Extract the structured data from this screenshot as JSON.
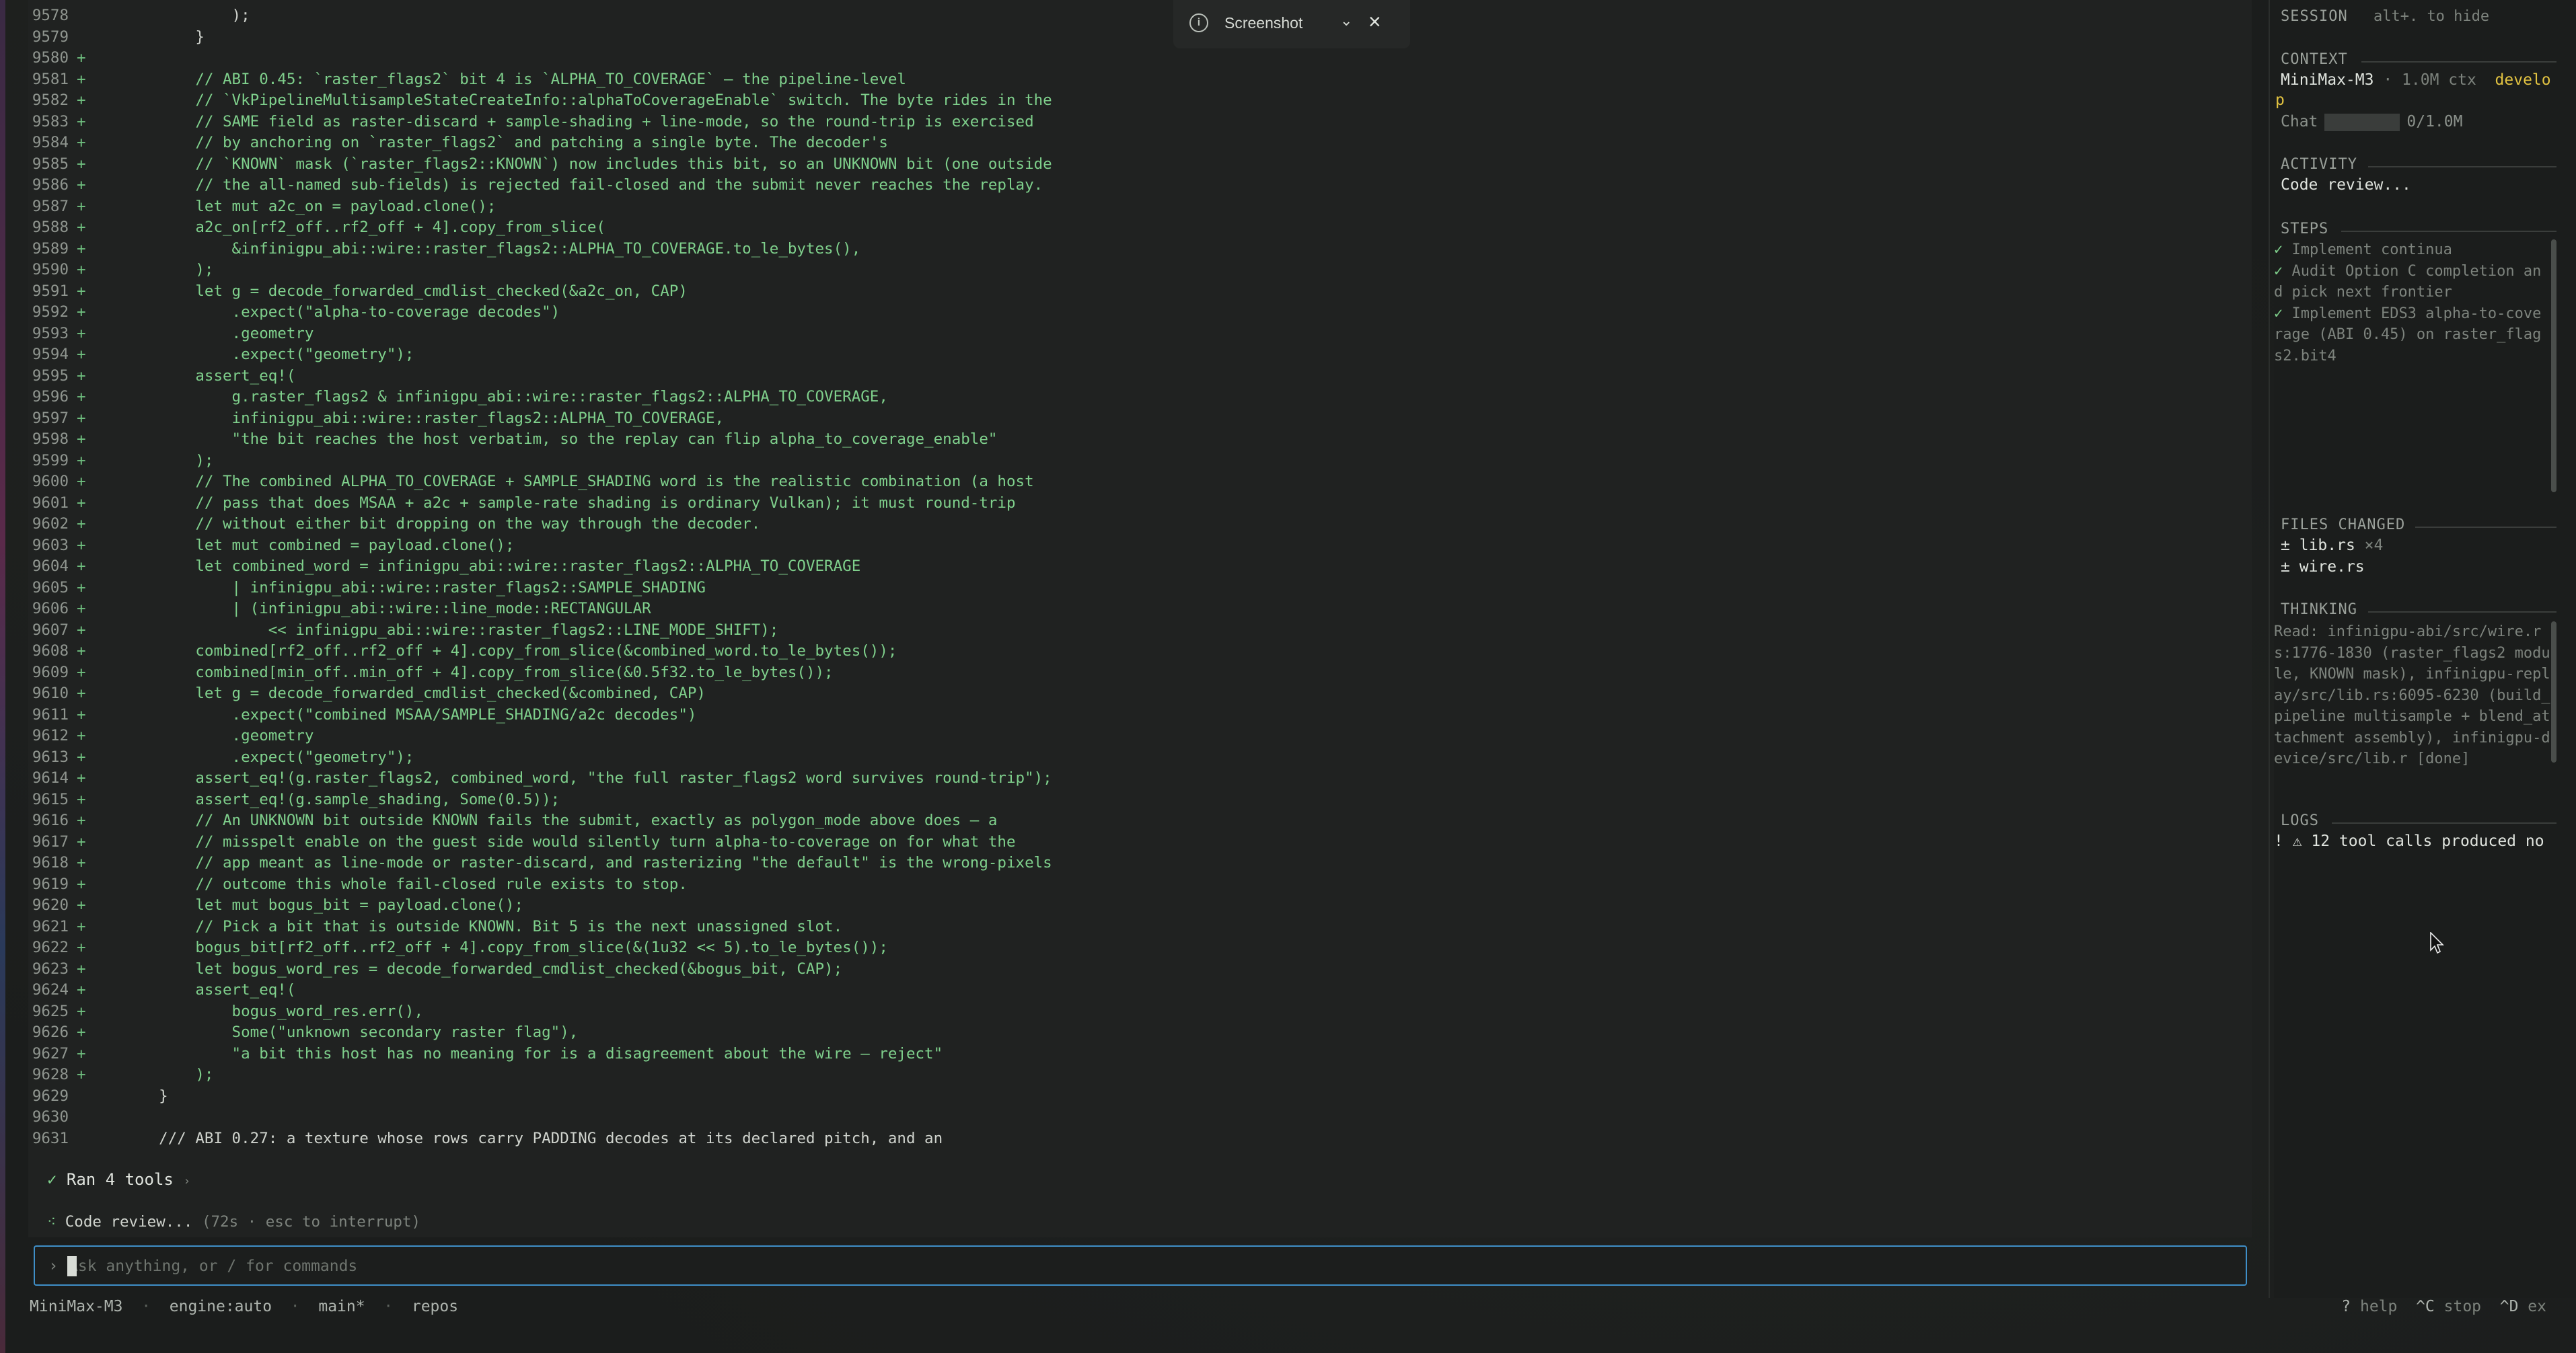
{
  "popup": {
    "title": "Screenshot",
    "info_icon": "info-icon",
    "chevron_icon": "chevron-down-icon",
    "close_icon": "close-icon"
  },
  "code_lines": [
    {
      "n": "9578",
      "m": "",
      "t": "            );",
      "k": "plain"
    },
    {
      "n": "9579",
      "m": "",
      "t": "        }",
      "k": "plain"
    },
    {
      "n": "9580",
      "m": "+",
      "t": "",
      "k": "add"
    },
    {
      "n": "9581",
      "m": "+",
      "t": "        // ABI 0.45: `raster_flags2` bit 4 is `ALPHA_TO_COVERAGE` — the pipeline-level",
      "k": "add"
    },
    {
      "n": "9582",
      "m": "+",
      "t": "        // `VkPipelineMultisampleStateCreateInfo::alphaToCoverageEnable` switch. The byte rides in the",
      "k": "add"
    },
    {
      "n": "9583",
      "m": "+",
      "t": "        // SAME field as raster-discard + sample-shading + line-mode, so the round-trip is exercised",
      "k": "add"
    },
    {
      "n": "9584",
      "m": "+",
      "t": "        // by anchoring on `raster_flags2` and patching a single byte. The decoder's",
      "k": "add"
    },
    {
      "n": "9585",
      "m": "+",
      "t": "        // `KNOWN` mask (`raster_flags2::KNOWN`) now includes this bit, so an UNKNOWN bit (one outside",
      "k": "add"
    },
    {
      "n": "9586",
      "m": "+",
      "t": "        // the all-named sub-fields) is rejected fail-closed and the submit never reaches the replay.",
      "k": "add"
    },
    {
      "n": "9587",
      "m": "+",
      "t": "        let mut a2c_on = payload.clone();",
      "k": "add"
    },
    {
      "n": "9588",
      "m": "+",
      "t": "        a2c_on[rf2_off..rf2_off + 4].copy_from_slice(",
      "k": "add"
    },
    {
      "n": "9589",
      "m": "+",
      "t": "            &infinigpu_abi::wire::raster_flags2::ALPHA_TO_COVERAGE.to_le_bytes(),",
      "k": "add"
    },
    {
      "n": "9590",
      "m": "+",
      "t": "        );",
      "k": "add"
    },
    {
      "n": "9591",
      "m": "+",
      "t": "        let g = decode_forwarded_cmdlist_checked(&a2c_on, CAP)",
      "k": "add"
    },
    {
      "n": "9592",
      "m": "+",
      "t": "            .expect(\"alpha-to-coverage decodes\")",
      "k": "add"
    },
    {
      "n": "9593",
      "m": "+",
      "t": "            .geometry",
      "k": "add"
    },
    {
      "n": "9594",
      "m": "+",
      "t": "            .expect(\"geometry\");",
      "k": "add"
    },
    {
      "n": "9595",
      "m": "+",
      "t": "        assert_eq!(",
      "k": "add"
    },
    {
      "n": "9596",
      "m": "+",
      "t": "            g.raster_flags2 & infinigpu_abi::wire::raster_flags2::ALPHA_TO_COVERAGE,",
      "k": "add"
    },
    {
      "n": "9597",
      "m": "+",
      "t": "            infinigpu_abi::wire::raster_flags2::ALPHA_TO_COVERAGE,",
      "k": "add"
    },
    {
      "n": "9598",
      "m": "+",
      "t": "            \"the bit reaches the host verbatim, so the replay can flip alpha_to_coverage_enable\"",
      "k": "add"
    },
    {
      "n": "9599",
      "m": "+",
      "t": "        );",
      "k": "add"
    },
    {
      "n": "9600",
      "m": "+",
      "t": "        // The combined ALPHA_TO_COVERAGE + SAMPLE_SHADING word is the realistic combination (a host",
      "k": "add"
    },
    {
      "n": "9601",
      "m": "+",
      "t": "        // pass that does MSAA + a2c + sample-rate shading is ordinary Vulkan); it must round-trip",
      "k": "add"
    },
    {
      "n": "9602",
      "m": "+",
      "t": "        // without either bit dropping on the way through the decoder.",
      "k": "add"
    },
    {
      "n": "9603",
      "m": "+",
      "t": "        let mut combined = payload.clone();",
      "k": "add"
    },
    {
      "n": "9604",
      "m": "+",
      "t": "        let combined_word = infinigpu_abi::wire::raster_flags2::ALPHA_TO_COVERAGE",
      "k": "add"
    },
    {
      "n": "9605",
      "m": "+",
      "t": "            | infinigpu_abi::wire::raster_flags2::SAMPLE_SHADING",
      "k": "add"
    },
    {
      "n": "9606",
      "m": "+",
      "t": "            | (infinigpu_abi::wire::line_mode::RECTANGULAR",
      "k": "add"
    },
    {
      "n": "9607",
      "m": "+",
      "t": "                << infinigpu_abi::wire::raster_flags2::LINE_MODE_SHIFT);",
      "k": "add"
    },
    {
      "n": "9608",
      "m": "+",
      "t": "        combined[rf2_off..rf2_off + 4].copy_from_slice(&combined_word.to_le_bytes());",
      "k": "add"
    },
    {
      "n": "9609",
      "m": "+",
      "t": "        combined[min_off..min_off + 4].copy_from_slice(&0.5f32.to_le_bytes());",
      "k": "add"
    },
    {
      "n": "9610",
      "m": "+",
      "t": "        let g = decode_forwarded_cmdlist_checked(&combined, CAP)",
      "k": "add"
    },
    {
      "n": "9611",
      "m": "+",
      "t": "            .expect(\"combined MSAA/SAMPLE_SHADING/a2c decodes\")",
      "k": "add"
    },
    {
      "n": "9612",
      "m": "+",
      "t": "            .geometry",
      "k": "add"
    },
    {
      "n": "9613",
      "m": "+",
      "t": "            .expect(\"geometry\");",
      "k": "add"
    },
    {
      "n": "9614",
      "m": "+",
      "t": "        assert_eq!(g.raster_flags2, combined_word, \"the full raster_flags2 word survives round-trip\");",
      "k": "add"
    },
    {
      "n": "9615",
      "m": "+",
      "t": "        assert_eq!(g.sample_shading, Some(0.5));",
      "k": "add"
    },
    {
      "n": "9616",
      "m": "+",
      "t": "        // An UNKNOWN bit outside KNOWN fails the submit, exactly as polygon_mode above does — a",
      "k": "add"
    },
    {
      "n": "9617",
      "m": "+",
      "t": "        // misspelt enable on the guest side would silently turn alpha-to-coverage on for what the",
      "k": "add"
    },
    {
      "n": "9618",
      "m": "+",
      "t": "        // app meant as line-mode or raster-discard, and rasterizing \"the default\" is the wrong-pixels",
      "k": "add"
    },
    {
      "n": "9619",
      "m": "+",
      "t": "        // outcome this whole fail-closed rule exists to stop.",
      "k": "add"
    },
    {
      "n": "9620",
      "m": "+",
      "t": "        let mut bogus_bit = payload.clone();",
      "k": "add"
    },
    {
      "n": "9621",
      "m": "+",
      "t": "        // Pick a bit that is outside KNOWN. Bit 5 is the next unassigned slot.",
      "k": "add"
    },
    {
      "n": "9622",
      "m": "+",
      "t": "        bogus_bit[rf2_off..rf2_off + 4].copy_from_slice(&(1u32 << 5).to_le_bytes());",
      "k": "add"
    },
    {
      "n": "9623",
      "m": "+",
      "t": "        let bogus_word_res = decode_forwarded_cmdlist_checked(&bogus_bit, CAP);",
      "k": "add"
    },
    {
      "n": "9624",
      "m": "+",
      "t": "        assert_eq!(",
      "k": "add"
    },
    {
      "n": "9625",
      "m": "+",
      "t": "            bogus_word_res.err(),",
      "k": "add"
    },
    {
      "n": "9626",
      "m": "+",
      "t": "            Some(\"unknown secondary raster flag\"),",
      "k": "add"
    },
    {
      "n": "9627",
      "m": "+",
      "t": "            \"a bit this host has no meaning for is a disagreement about the wire — reject\"",
      "k": "add"
    },
    {
      "n": "9628",
      "m": "+",
      "t": "        );",
      "k": "add"
    },
    {
      "n": "9629",
      "m": "",
      "t": "    }",
      "k": "plain"
    },
    {
      "n": "9630",
      "m": "",
      "t": "",
      "k": "plain"
    },
    {
      "n": "9631",
      "m": "",
      "t": "    /// ABI 0.27: a texture whose rows carry PADDING decodes at its declared pitch, and an",
      "k": "plain"
    }
  ],
  "tools": {
    "check": "✓",
    "label": "Ran 4 tools",
    "chevron": "›"
  },
  "review": {
    "spinner": "⁖",
    "label": "Code review...",
    "meta": "(72s · esc to interrupt)"
  },
  "input": {
    "prompt": "›",
    "placeholder": "Ask anything, or / for commands",
    "value": ""
  },
  "status": {
    "model": "MiniMax-M3",
    "engine": "engine:auto",
    "branch": "main*",
    "dir": "repos",
    "sep": "·"
  },
  "status_right": {
    "help_key": "?",
    "help": "help",
    "stop_key": "^C",
    "stop": "stop",
    "exit_key": "^D",
    "exit": "ex"
  },
  "side": {
    "session_label": "SESSION",
    "session_hint": "alt+. to hide",
    "context_label": "CONTEXT",
    "context_model": "MiniMax-M3",
    "context_ctx": "· 1.0M ctx",
    "context_branch": "develo",
    "context_branch_2": "p",
    "chat_label": "Chat",
    "chat_value": "0/1.0M",
    "activity_label": "ACTIVITY",
    "activity_value": "Code review...",
    "steps_label": "STEPS",
    "steps": [
      {
        "check": "✓",
        "text": "Implement continua"
      },
      {
        "check": "✓",
        "text": "Audit Option C completion and pick next frontier"
      },
      {
        "check": "✓",
        "text": "Implement EDS3 alpha-to-coverage (ABI 0.45) on raster_flags2.bit4"
      }
    ],
    "files_label": "FILES CHANGED",
    "files": [
      {
        "mark": "±",
        "name": "lib.rs",
        "count": "×4"
      },
      {
        "mark": "±",
        "name": "wire.rs",
        "count": ""
      }
    ],
    "thinking_label": "THINKING",
    "thinking_text": "Read: infinigpu-abi/src/wire.rs:1776-1830 (raster_flags2 module, KNOWN mask), infinigpu-replay/src/lib.rs:6095-6230 (build_pipeline multisample + blend_attachment assembly), infinigpu-device/src/lib.r [done]",
    "logs_label": "LOGS",
    "logs_text": "! ⚠ 12 tool calls produced no"
  }
}
